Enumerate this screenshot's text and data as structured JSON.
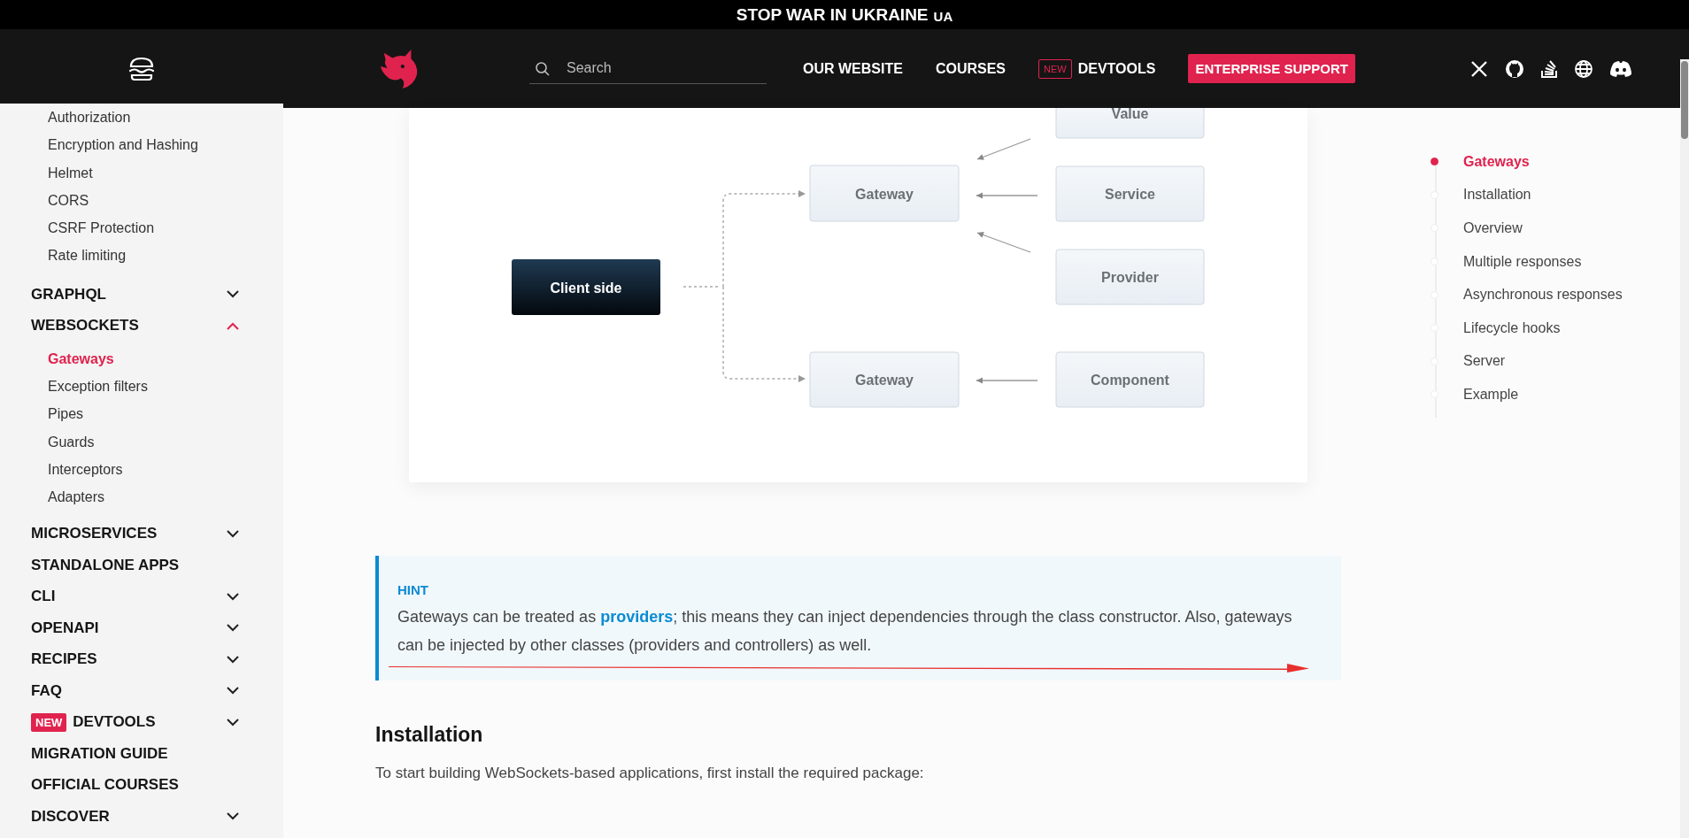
{
  "banner": {
    "text": "STOP WAR IN UKRAINE",
    "tag": "UA"
  },
  "header": {
    "search": {
      "placeholder": "Search"
    },
    "nav": [
      {
        "label": "OUR WEBSITE",
        "kind": "link"
      },
      {
        "label": "COURSES",
        "kind": "link"
      },
      {
        "label": "DEVTOOLS",
        "kind": "link",
        "badge": "NEW"
      },
      {
        "label": "ENTERPRISE SUPPORT",
        "kind": "button"
      }
    ]
  },
  "sidebar": {
    "links": [
      {
        "label": "Authorization",
        "selected": false
      },
      {
        "label": "Encryption and Hashing",
        "selected": false
      },
      {
        "label": "Helmet",
        "selected": false
      },
      {
        "label": "CORS",
        "selected": false
      },
      {
        "label": "CSRF Protection",
        "selected": false
      },
      {
        "label": "Rate limiting",
        "selected": false
      }
    ],
    "sections": [
      {
        "label": "GRAPHQL",
        "expanded": false
      },
      {
        "label": "WEBSOCKETS",
        "expanded": true,
        "children": [
          {
            "label": "Gateways",
            "selected": true
          },
          {
            "label": "Exception filters",
            "selected": false
          },
          {
            "label": "Pipes",
            "selected": false
          },
          {
            "label": "Guards",
            "selected": false
          },
          {
            "label": "Interceptors",
            "selected": false
          },
          {
            "label": "Adapters",
            "selected": false
          }
        ]
      },
      {
        "label": "MICROSERVICES",
        "expanded": false
      },
      {
        "label": "STANDALONE APPS"
      },
      {
        "label": "CLI",
        "expanded": false
      },
      {
        "label": "OPENAPI",
        "expanded": false
      },
      {
        "label": "RECIPES",
        "expanded": false
      },
      {
        "label": "FAQ",
        "expanded": false
      },
      {
        "label": "DEVTOOLS",
        "badge": "NEW",
        "expanded": false
      },
      {
        "label": "MIGRATION GUIDE"
      },
      {
        "label": "OFFICIAL COURSES"
      },
      {
        "label": "DISCOVER",
        "expanded": false
      }
    ]
  },
  "diagram": {
    "nodes": [
      {
        "label": "Client side",
        "kind": "dark"
      },
      {
        "label": "Gateway",
        "kind": "light"
      },
      {
        "label": "Value",
        "kind": "light"
      },
      {
        "label": "Service",
        "kind": "light"
      },
      {
        "label": "Provider",
        "kind": "light"
      },
      {
        "label": "Gateway",
        "kind": "light"
      },
      {
        "label": "Component",
        "kind": "light"
      }
    ]
  },
  "hint": {
    "title": "HINT",
    "before": "Gateways can be treated as ",
    "link": "providers",
    "after": "; this means they can inject dependencies through the class constructor. Also, gateways can be injected by other classes (providers and controllers) as well."
  },
  "installation": {
    "heading": "Installation",
    "text": "To start building WebSockets-based applications, first install the required package:"
  },
  "toc": [
    {
      "label": "Gateways",
      "selected": true
    },
    {
      "label": "Installation",
      "selected": false
    },
    {
      "label": "Overview",
      "selected": false
    },
    {
      "label": "Multiple responses",
      "selected": false
    },
    {
      "label": "Asynchronous responses",
      "selected": false
    },
    {
      "label": "Lifecycle hooks",
      "selected": false
    },
    {
      "label": "Server",
      "selected": false
    },
    {
      "label": "Example",
      "selected": false
    }
  ]
}
